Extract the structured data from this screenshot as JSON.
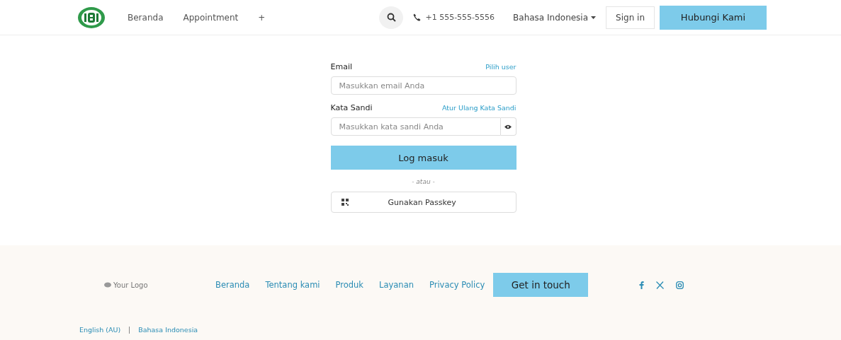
{
  "header": {
    "nav": [
      "Beranda",
      "Appointment",
      "+"
    ],
    "phone": "+1 555-555-5556",
    "language": "Bahasa Indonesia",
    "sign_in": "Sign in",
    "contact": "Hubungi Kami"
  },
  "login": {
    "email_label": "Email",
    "email_link": "Pilih user",
    "email_placeholder": "Masukkan email Anda",
    "password_label": "Kata Sandi",
    "password_link": "Atur Ulang Kata Sandi",
    "password_placeholder": "Masukkan kata sandi Anda",
    "submit": "Log masuk",
    "separator": "- atau -",
    "passkey": "Gunakan Passkey"
  },
  "footer": {
    "logo": "Your Logo",
    "links": [
      "Beranda",
      "Tentang kami",
      "Produk",
      "Layanan",
      "Privacy Policy"
    ],
    "cta": "Get in touch",
    "languages": [
      "English (AU)",
      "Bahasa Indonesia"
    ]
  }
}
